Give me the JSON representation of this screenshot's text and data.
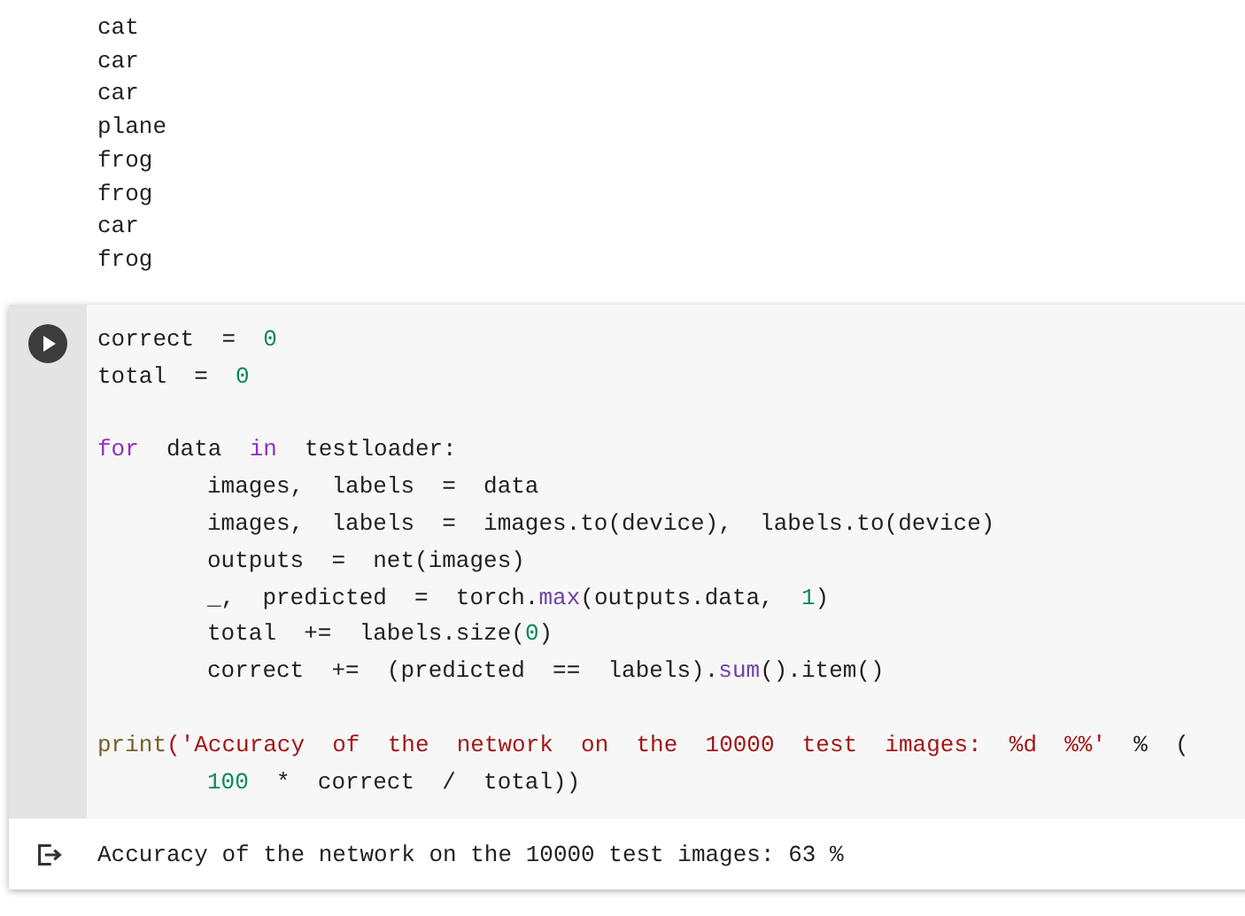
{
  "previous_output": {
    "lines": [
      "cat",
      "car",
      "car",
      "plane",
      "frog",
      "frog",
      "car",
      "frog"
    ]
  },
  "code_cell": {
    "blocks": [
      {
        "lines": [
          {
            "indented": false,
            "tokens": [
              {
                "text": "correct  =  ",
                "kind": "plain"
              },
              {
                "text": "0",
                "kind": "number"
              }
            ]
          },
          {
            "indented": false,
            "tokens": [
              {
                "text": "total  =  ",
                "kind": "plain"
              },
              {
                "text": "0",
                "kind": "number"
              }
            ]
          }
        ]
      },
      {
        "lines": [
          {
            "indented": false,
            "tokens": [
              {
                "text": "for",
                "kind": "keyword"
              },
              {
                "text": "  data  ",
                "kind": "plain"
              },
              {
                "text": "in",
                "kind": "keyword"
              },
              {
                "text": "  testloader:",
                "kind": "plain"
              }
            ]
          },
          {
            "indented": true,
            "tokens": [
              {
                "text": "images,  labels  =  data",
                "kind": "plain"
              }
            ]
          },
          {
            "indented": true,
            "tokens": [
              {
                "text": "images,  labels  =  images.to(device),  labels.to(device)",
                "kind": "plain"
              }
            ]
          },
          {
            "indented": true,
            "tokens": [
              {
                "text": "outputs  =  net(images)",
                "kind": "plain"
              }
            ]
          },
          {
            "indented": true,
            "tokens": [
              {
                "text": "_,  predicted  =  torch.",
                "kind": "plain"
              },
              {
                "text": "max",
                "kind": "method"
              },
              {
                "text": "(outputs.data,  ",
                "kind": "plain"
              },
              {
                "text": "1",
                "kind": "number"
              },
              {
                "text": ")",
                "kind": "plain"
              }
            ]
          },
          {
            "indented": true,
            "tokens": [
              {
                "text": "total  +=  labels.size(",
                "kind": "plain"
              },
              {
                "text": "0",
                "kind": "number"
              },
              {
                "text": ")",
                "kind": "plain"
              }
            ]
          },
          {
            "indented": true,
            "tokens": [
              {
                "text": "correct  +=  (predicted  ==  labels).",
                "kind": "plain"
              },
              {
                "text": "sum",
                "kind": "method"
              },
              {
                "text": "().item()",
                "kind": "plain"
              }
            ]
          }
        ]
      },
      {
        "lines": [
          {
            "indented": false,
            "tokens": [
              {
                "text": "print",
                "kind": "builtin"
              },
              {
                "text": "('Accuracy  of  the  network  on  the  10000  test  images:  %d  %%'",
                "kind": "string"
              },
              {
                "text": "  %  (",
                "kind": "plain"
              }
            ]
          },
          {
            "indented": true,
            "tokens": [
              {
                "text": "100",
                "kind": "number"
              },
              {
                "text": "  *  correct  /  total))",
                "kind": "plain"
              }
            ]
          }
        ]
      }
    ],
    "output": "Accuracy of the network on the 10000 test images: 63 %"
  }
}
